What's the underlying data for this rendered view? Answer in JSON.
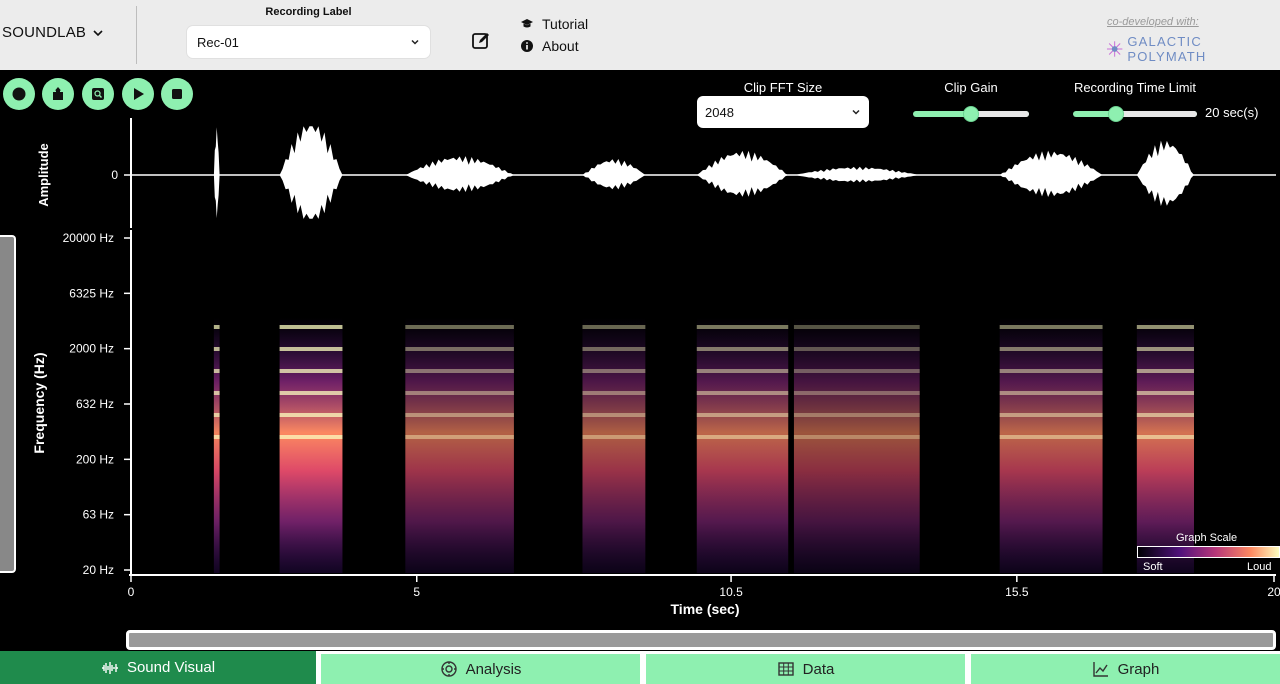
{
  "header": {
    "brand": "SOUNDLAB",
    "recording_label_title": "Recording Label",
    "recording_label_value": "Rec-01",
    "menu": {
      "tutorial": "Tutorial",
      "about": "About"
    },
    "codeveloped": "co-developed with:",
    "partner": "GALACTIC POLYMATH"
  },
  "toolbar": {
    "buttons": [
      "record-icon",
      "upload-icon",
      "search-file-icon",
      "play-icon",
      "stop-icon"
    ]
  },
  "controls": {
    "fft_label": "Clip FFT Size",
    "fft_value": "2048",
    "gain_label": "Clip Gain",
    "gain_level": 0.5,
    "time_limit_label": "Recording Time Limit",
    "time_limit_level": 0.35,
    "time_limit_value": "20 sec(s)"
  },
  "chart_data": {
    "type": "heatmap",
    "waveform_ylabel": "Amplitude",
    "waveform_ytick": "0",
    "ylabel": "Frequency (Hz)",
    "yticks": [
      "20000 Hz",
      "6325 Hz",
      "2000 Hz",
      "632 Hz",
      "200 Hz",
      "63 Hz",
      "20 Hz"
    ],
    "xlabel": "Time (sec)",
    "xticks": [
      0,
      5,
      10.5,
      15.5,
      20
    ],
    "xlim": [
      0,
      20
    ],
    "legend_title": "Graph Scale",
    "legend_low": "Soft",
    "legend_high": "Loud",
    "segments": [
      {
        "start": 1.45,
        "end": 1.55,
        "amp": 0.9
      },
      {
        "start": 2.6,
        "end": 3.7,
        "amp": 1.0
      },
      {
        "start": 4.8,
        "end": 6.7,
        "amp": 0.35
      },
      {
        "start": 7.9,
        "end": 9.0,
        "amp": 0.3
      },
      {
        "start": 9.9,
        "end": 11.5,
        "amp": 0.45
      },
      {
        "start": 11.6,
        "end": 13.8,
        "amp": 0.15
      },
      {
        "start": 15.2,
        "end": 17.0,
        "amp": 0.45
      },
      {
        "start": 17.6,
        "end": 18.6,
        "amp": 0.65
      }
    ]
  },
  "tabs": [
    {
      "label": "Sound Visual",
      "active": true
    },
    {
      "label": "Analysis",
      "active": false
    },
    {
      "label": "Data",
      "active": false
    },
    {
      "label": "Graph",
      "active": false
    }
  ],
  "colors": {
    "accent": "#8ef0b0",
    "active_tab": "#1f8b4c",
    "header_bg": "#ececec"
  }
}
